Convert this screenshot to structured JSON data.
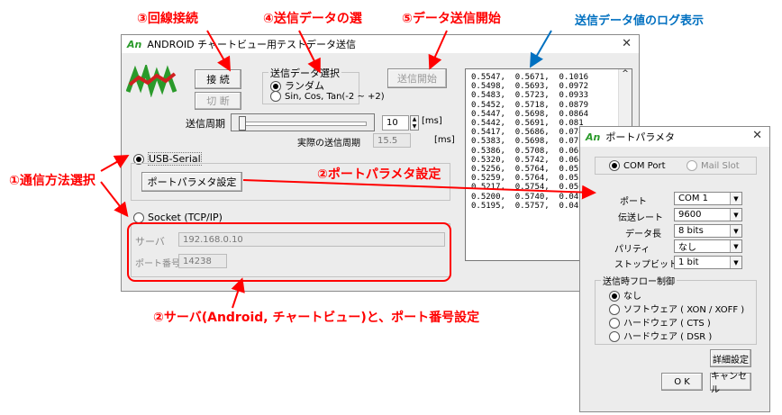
{
  "annotations": {
    "a1": "①通信方法選択",
    "a2_port": "②ポートパラメタ設定",
    "a2_server": "②サーバ(Android, チャートビュー)と、ポート番号設定",
    "a3": "③回線接続",
    "a4": "④送信データの選",
    "a5": "⑤データ送信開始",
    "log": "送信データ値のログ表示"
  },
  "main_window": {
    "logo": "An",
    "title": "ANDROID チャートビュー用テストデータ送信",
    "connect_label": "接 続",
    "disconnect_label": "切 断",
    "send_start_label": "送信開始",
    "data_select": {
      "legend": "送信データ選択",
      "option_random": "ランダム",
      "option_trig": "Sin, Cos, Tan(-2 ~ +2)"
    },
    "period_label": "送信周期",
    "period_value": "10",
    "period_unit": "[ms]",
    "actual_period_label": "実際の送信周期",
    "actual_period_value": "15.5",
    "actual_period_unit": "[ms]",
    "usb_serial_label": "USB-Serial",
    "port_param_button": "ポートパラメタ設定",
    "socket_label": "Socket (TCP/IP)",
    "server_label": "サーバ",
    "server_value": "192.168.0.10",
    "port_no_label": "ポート番号",
    "port_no_value": "14238",
    "log_lines": [
      "0.5547,  0.5671,  0.1016",
      "0.5498,  0.5693,  0.0972",
      "0.5483,  0.5723,  0.0933",
      "0.5452,  0.5718,  0.0879",
      "0.5447,  0.5698,  0.0864",
      "0.5442,  0.5691,  0.081",
      "0.5417,  0.5686,  0.074",
      "0.5383,  0.5698,  0.072",
      "0.5386,  0.5708,  0.067",
      "0.5320,  0.5742,  0.064",
      "0.5256,  0.5764,  0.059",
      "0.5259,  0.5764,  0.053",
      "0.5217,  0.5754,  0.050",
      "0.5200,  0.5740,  0.043",
      "0.5195,  0.5757,  0.045"
    ]
  },
  "port_dialog": {
    "logo": "An",
    "title": "ポートパラメタ",
    "com_port_label": "COM Port",
    "mail_slot_label": "Mail Slot",
    "port_label": "ポート",
    "port_value": "COM 1",
    "baud_label": "伝送レート",
    "baud_value": "9600",
    "data_len_label": "データ長",
    "data_len_value": "8 bits",
    "parity_label": "パリティ",
    "parity_value": "なし",
    "stop_bit_label": "ストップビット",
    "stop_bit_value": "1 bit",
    "flow_legend": "送信時フロー制御",
    "flow_options": [
      "なし",
      "ソフトウェア ( XON / XOFF )",
      "ハードウェア ( CTS )",
      "ハードウェア ( DSR )"
    ],
    "detail_button": "詳細設定",
    "ok_button": "O K",
    "cancel_button": "キャンセル"
  },
  "colors": {
    "annotation": "#ff0000",
    "log_annotation": "#0070c0"
  },
  "icons": [
    "close-icon",
    "spinner-up-icon",
    "spinner-down-icon",
    "scroll-up-icon",
    "scroll-down-icon",
    "dropdown-arrow-icon",
    "app-logo-icon"
  ]
}
